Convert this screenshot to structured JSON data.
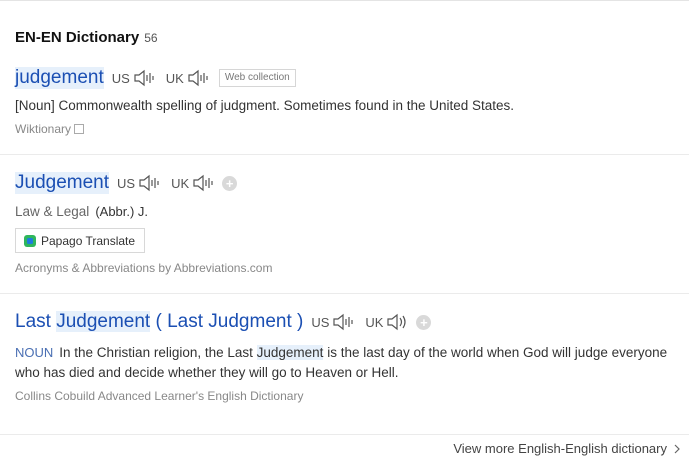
{
  "header": {
    "title": "EN-EN Dictionary",
    "count": "56"
  },
  "entries": [
    {
      "word": "judgement",
      "us_label": "US",
      "uk_label": "UK",
      "tag": "Web collection",
      "definition": "[Noun] Commonwealth spelling of judgment. Sometimes found in the United States.",
      "source": "Wiktionary"
    },
    {
      "word": "Judgement",
      "us_label": "US",
      "uk_label": "UK",
      "field": "Law & Legal",
      "abbr": "(Abbr.) J.",
      "papago": "Papago Translate",
      "source": "Acronyms & Abbreviations by Abbreviations.com"
    },
    {
      "word_prefix": "Last ",
      "word_highlight": "Judgement",
      "word_suffix": " ( Last Judgment )",
      "us_label": "US",
      "uk_label": "UK",
      "pos": "NOUN",
      "def_before": "In the Christian religion, the Last ",
      "def_highlight": "Judgement",
      "def_after": " is the last day of the world when God will judge everyone who has died and decide whether they will go to Heaven or Hell.",
      "source": "Collins Cobuild Advanced Learner's English Dictionary"
    }
  ],
  "footer": {
    "more_link": "View more English-English dictionary"
  },
  "icons": {
    "speaker": "speaker-icon",
    "plus": "plus-icon",
    "copy": "copy-icon",
    "papago": "papago-logo-icon",
    "chevron": "chevron-right-icon"
  },
  "colors": {
    "headword": "#1b4fb3",
    "highlight": "#e6f0fb",
    "pos": "#4a6fb3"
  }
}
